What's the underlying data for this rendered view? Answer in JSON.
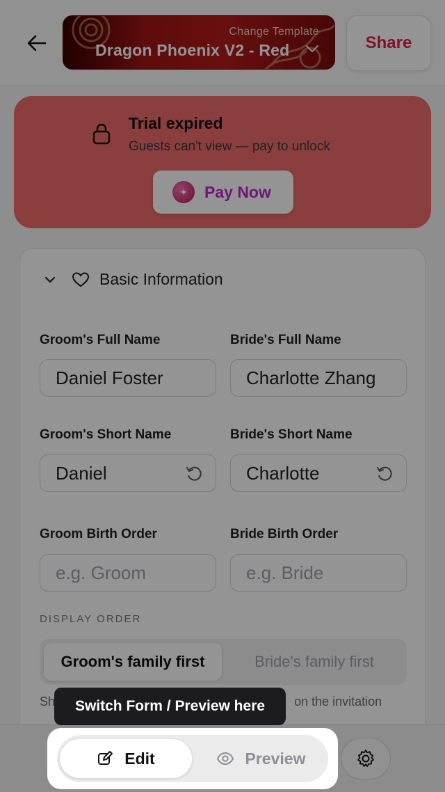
{
  "header": {
    "back_icon": "arrow-left-icon",
    "change_template_label": "Change Template",
    "template_name": "Dragon Phoenix V2 - Red",
    "share_label": "Share"
  },
  "trial_banner": {
    "title": "Trial expired",
    "subtitle": "Guests can't view — pay to unlock",
    "pay_label": "Pay Now",
    "color": "#f06b6b"
  },
  "form": {
    "section_title": "Basic Information",
    "groom_full_name": {
      "label": "Groom's Full Name",
      "value": "Daniel Foster"
    },
    "bride_full_name": {
      "label": "Bride's Full Name",
      "value": "Charlotte Zhang"
    },
    "groom_short_name": {
      "label": "Groom's Short Name",
      "value": "Daniel"
    },
    "bride_short_name": {
      "label": "Bride's Short Name",
      "value": "Charlotte"
    },
    "groom_birth_order": {
      "label": "Groom Birth Order",
      "placeholder": "e.g. Groom"
    },
    "bride_birth_order": {
      "label": "Bride Birth Order",
      "placeholder": "e.g. Bride"
    },
    "display_order_label": "DISPLAY ORDER",
    "display_order_options": [
      "Groom's family first",
      "Bride's family first"
    ],
    "display_order_selected": "Groom's family first",
    "help_text_left": "Sh",
    "help_text_right": "on the invitation"
  },
  "bottom_nav": {
    "edit_label": "Edit",
    "preview_label": "Preview",
    "active": "Edit"
  },
  "tooltip": {
    "text": "Switch Form / Preview here"
  },
  "colors": {
    "accent": "#e11d48",
    "pay_text": "#c026d3"
  }
}
